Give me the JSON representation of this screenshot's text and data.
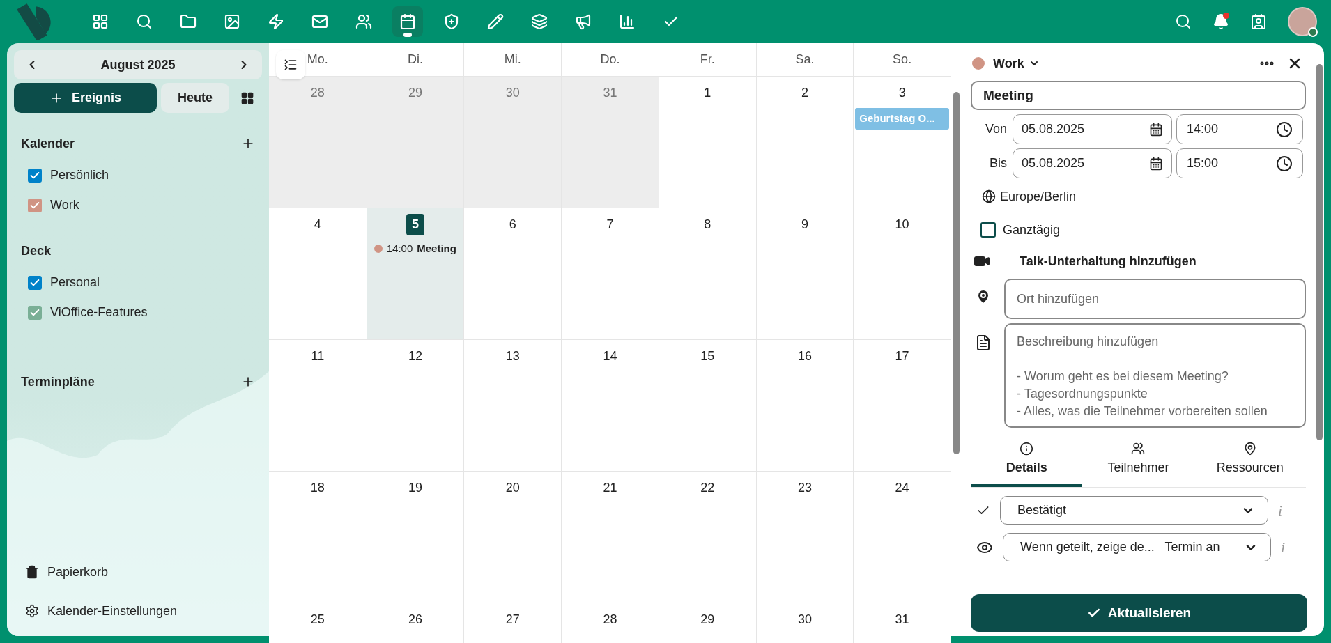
{
  "topbar": {
    "apps": [
      {
        "kind": "grid",
        "selected": false
      },
      {
        "kind": "search-app",
        "selected": false
      },
      {
        "kind": "folder",
        "selected": false
      },
      {
        "kind": "image",
        "selected": false
      },
      {
        "kind": "bolt",
        "selected": false
      },
      {
        "kind": "mail",
        "selected": false
      },
      {
        "kind": "people",
        "selected": false
      },
      {
        "kind": "calendar",
        "selected": true
      },
      {
        "kind": "shield",
        "selected": false
      },
      {
        "kind": "pencil",
        "selected": false
      },
      {
        "kind": "stack",
        "selected": false
      },
      {
        "kind": "megaphone",
        "selected": false
      },
      {
        "kind": "chart",
        "selected": false
      },
      {
        "kind": "check",
        "selected": false
      }
    ],
    "notifications": {
      "unread": true
    }
  },
  "sidebar": {
    "month": "August 2025",
    "new_event": "Ereignis",
    "today": "Heute",
    "sections": [
      {
        "title": "Kalender",
        "addable": true,
        "items": [
          {
            "label": "Persönlich",
            "checked": true,
            "color": "#0082c9"
          },
          {
            "label": "Work",
            "checked": true,
            "color": "#d09484"
          }
        ]
      },
      {
        "title": "Deck",
        "addable": false,
        "items": [
          {
            "label": "Personal",
            "checked": true,
            "color": "#0082c9"
          },
          {
            "label": "ViOffice-Features",
            "checked": true,
            "color": "#7aaf96"
          }
        ]
      },
      {
        "title": "Terminpläne",
        "addable": true
      }
    ],
    "footer": [
      {
        "kind": "trash",
        "label": "Papierkorb"
      },
      {
        "kind": "settings",
        "label": "Kalender-Einstellungen"
      }
    ]
  },
  "calendar": {
    "weekdays": [
      "Mo.",
      "Di.",
      "Mi.",
      "Do.",
      "Fr.",
      "Sa.",
      "So."
    ],
    "weeks": [
      [
        {
          "day": "28",
          "muted": true
        },
        {
          "day": "29",
          "muted": true
        },
        {
          "day": "30",
          "muted": true
        },
        {
          "day": "31",
          "muted": true
        },
        {
          "day": "1",
          "muted": false
        },
        {
          "day": "2",
          "muted": false
        },
        {
          "day": "3",
          "muted": false,
          "events": [
            {
              "kind": "allday",
              "title": "Geburtstag O...",
              "color": "#7fbfe4"
            }
          ]
        }
      ],
      [
        {
          "day": "4",
          "muted": false
        },
        {
          "day": "5",
          "muted": false,
          "today": true,
          "events": [
            {
              "kind": "timed",
              "time": "14:00",
              "title": "Meeting",
              "color": "#d09484"
            }
          ]
        },
        {
          "day": "6",
          "muted": false
        },
        {
          "day": "7",
          "muted": false
        },
        {
          "day": "8",
          "muted": false
        },
        {
          "day": "9",
          "muted": false
        },
        {
          "day": "10",
          "muted": false
        }
      ],
      [
        {
          "day": "11",
          "muted": false
        },
        {
          "day": "12",
          "muted": false
        },
        {
          "day": "13",
          "muted": false
        },
        {
          "day": "14",
          "muted": false
        },
        {
          "day": "15",
          "muted": false
        },
        {
          "day": "16",
          "muted": false
        },
        {
          "day": "17",
          "muted": false
        }
      ],
      [
        {
          "day": "18",
          "muted": false
        },
        {
          "day": "19",
          "muted": false
        },
        {
          "day": "20",
          "muted": false
        },
        {
          "day": "21",
          "muted": false
        },
        {
          "day": "22",
          "muted": false
        },
        {
          "day": "23",
          "muted": false
        },
        {
          "day": "24",
          "muted": false
        }
      ],
      [
        {
          "day": "25",
          "muted": false
        },
        {
          "day": "26",
          "muted": false
        },
        {
          "day": "27",
          "muted": false
        },
        {
          "day": "28",
          "muted": false
        },
        {
          "day": "29",
          "muted": false
        },
        {
          "day": "30",
          "muted": false
        },
        {
          "day": "31",
          "muted": false
        }
      ]
    ]
  },
  "editor": {
    "calendar": {
      "name": "Work",
      "color": "#d09484"
    },
    "title": "Meeting",
    "from": {
      "label": "Von",
      "date": "05.08.2025",
      "time": "14:00"
    },
    "to": {
      "label": "Bis",
      "date": "05.08.2025",
      "time": "15:00"
    },
    "timezone": "Europe/Berlin",
    "all_day": {
      "label": "Ganztägig",
      "checked": false
    },
    "talk": "Talk-Unterhaltung hinzufügen",
    "location": {
      "placeholder": "Ort hinzufügen"
    },
    "description": {
      "placeholder": "Beschreibung hinzufügen\n\n- Worum geht es bei diesem Meeting?\n- Tagesordnungspunkte\n- Alles, was die Teilnehmer vorbereiten sollen"
    },
    "tabs": [
      {
        "kind": "info",
        "label": "Details",
        "selected": true
      },
      {
        "kind": "people",
        "label": "Teilnehmer",
        "selected": false
      },
      {
        "kind": "pin",
        "label": "Ressourcen",
        "selected": false
      }
    ],
    "selects": [
      {
        "kind": "status",
        "value": "Bestätigt",
        "info": "i"
      },
      {
        "kind": "visibility",
        "value": "Wenn geteilt, zeige de...   Termin an",
        "info": "i"
      }
    ],
    "submit": "Aktualisieren"
  }
}
